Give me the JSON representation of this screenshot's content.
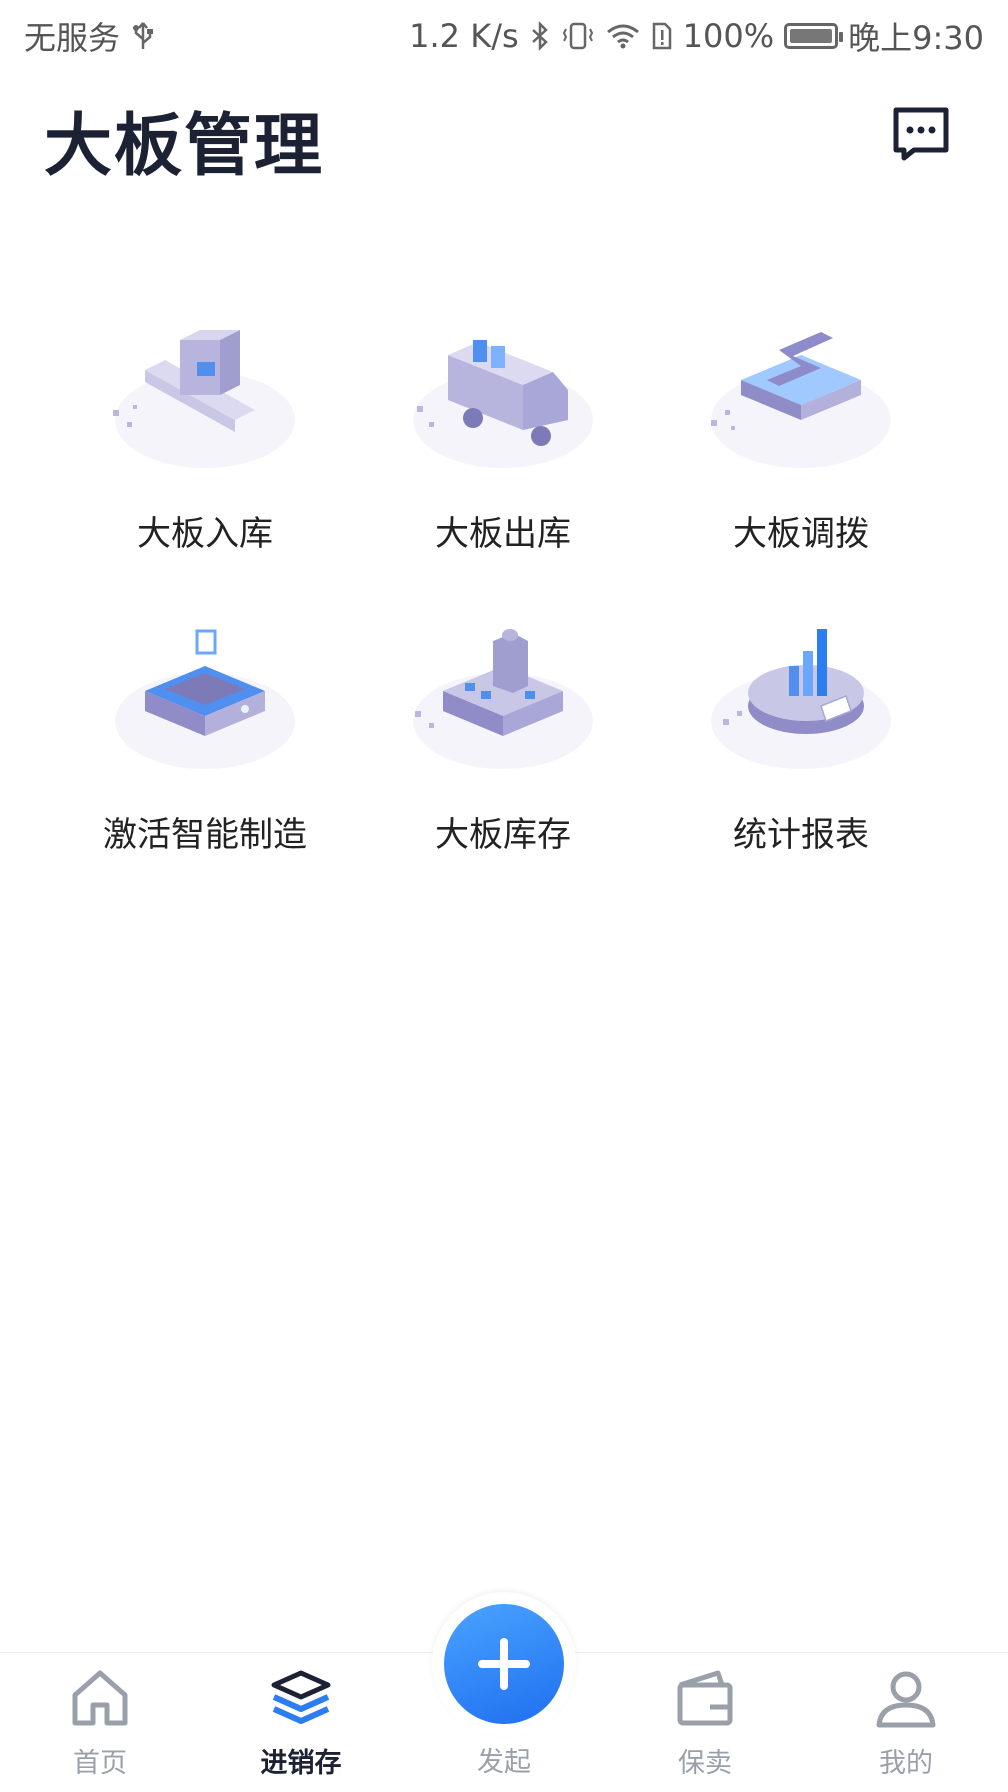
{
  "status_bar": {
    "carrier": "无服务",
    "net_speed": "1.2 K/s",
    "battery": "100%",
    "battery_level": 1.0,
    "time": "晚上9:30",
    "icons": [
      "usb-icon",
      "bluetooth-icon",
      "vibrate-icon",
      "wifi-icon",
      "sim-alert-icon",
      "battery-icon"
    ]
  },
  "header": {
    "title": "大板管理",
    "message_icon": "message-more-icon"
  },
  "features": [
    {
      "label": "大板入库",
      "icon": "inbound-conveyor-illustration"
    },
    {
      "label": "大板出库",
      "icon": "outbound-truck-illustration"
    },
    {
      "label": "大板调拨",
      "icon": "transfer-arrow-illustration"
    },
    {
      "label": "激活智能制造",
      "icon": "smart-chip-illustration"
    },
    {
      "label": "大板库存",
      "icon": "warehouse-building-illustration"
    },
    {
      "label": "统计报表",
      "icon": "report-chart-illustration"
    }
  ],
  "tabbar": {
    "items": [
      {
        "label": "首页",
        "icon": "home-icon",
        "active": false
      },
      {
        "label": "进销存",
        "icon": "layers-icon",
        "active": true
      },
      {
        "label": "发起",
        "icon": "plus-icon",
        "active": false
      },
      {
        "label": "保卖",
        "icon": "wallet-icon",
        "active": false
      },
      {
        "label": "我的",
        "icon": "user-icon",
        "active": false
      }
    ]
  },
  "colors": {
    "accent": "#2b7df0",
    "title": "#1c2233",
    "inactive_tab": "#9aa0aa",
    "illustration": "#a9a6d6"
  }
}
